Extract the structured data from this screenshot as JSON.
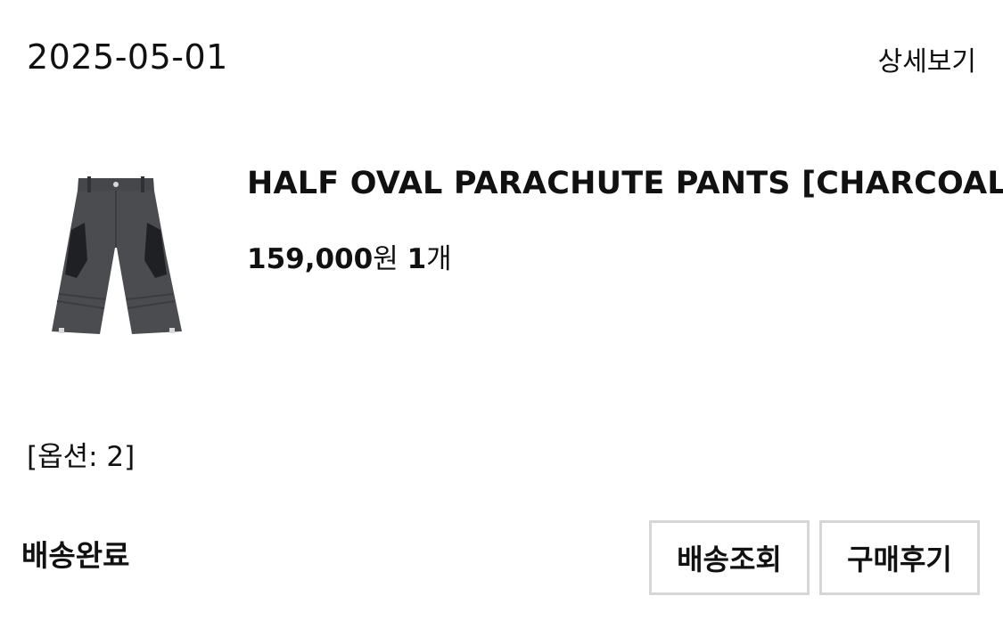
{
  "order": {
    "date": "2025-05-01",
    "detail_link": "상세보기"
  },
  "product": {
    "image_icon": "charcoal-parachute-pants",
    "name": "HALF OVAL PARACHUTE PANTS [CHARCOAL]",
    "price_amount": "159,000",
    "price_unit": "원",
    "quantity_number": "1",
    "quantity_unit": "개",
    "option_text": "[옵션: 2]"
  },
  "status": {
    "label": "배송완료"
  },
  "actions": {
    "track_label": "배송조회",
    "review_label": "구매후기"
  },
  "colors": {
    "pants_main": "#4a4c50",
    "pants_dark": "#1f2023",
    "button_border": "#d6d6d6",
    "text": "#111111"
  }
}
